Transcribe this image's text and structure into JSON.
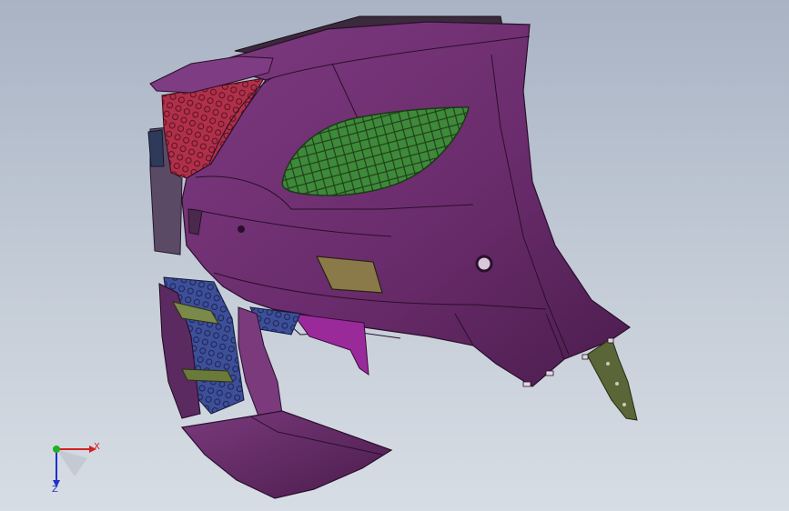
{
  "viewport": {
    "background_top": "#a9b3c4",
    "background_bottom": "#d7dde4"
  },
  "model": {
    "body_color": "#6a2c6c",
    "body_edge_color": "#2a0f2c",
    "vent_mesh_color": "#3f8a3a",
    "upper_grille_color": "#b0304a",
    "lower_grille_color": "#3e4f9a",
    "reflector_color": "#8a7a4a",
    "bracket_color": "#5a6638",
    "inner_panel_color": "#9a2a9a"
  },
  "triad": {
    "x_label": "X",
    "z_label": "Z",
    "x_color": "#d42020",
    "y_color": "#20b020",
    "z_color": "#2030c8"
  }
}
